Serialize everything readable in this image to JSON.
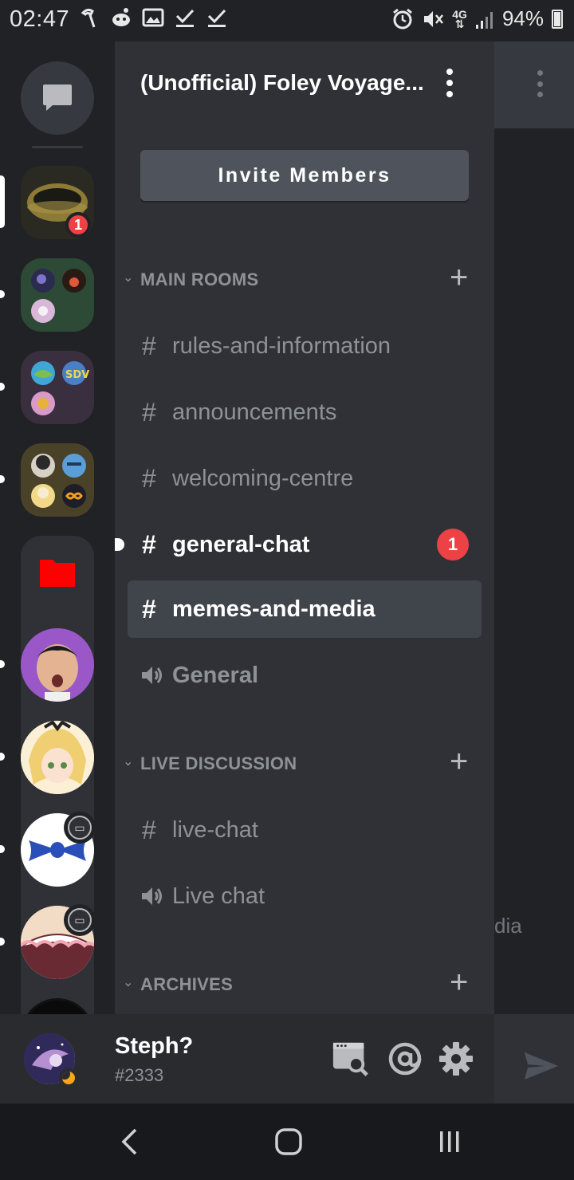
{
  "status_bar": {
    "time": "02:47",
    "left_icons": [
      "tiktok-icon",
      "reddit-icon",
      "image-icon",
      "check-icon",
      "check-icon"
    ],
    "right_icons": [
      "alarm-icon",
      "mute-icon",
      "network-4g-icon",
      "signal-icon"
    ],
    "network": "4G",
    "battery": "94%"
  },
  "rail": {
    "servers": [
      {
        "name": "ring-server",
        "badge": "1",
        "colors": [
          "#3b3b2a",
          "#a28b3c"
        ]
      },
      {
        "name": "folder-server-1",
        "colors": [
          "#2e4a37"
        ]
      },
      {
        "name": "folder-server-2",
        "colors": [
          "#3d3040"
        ]
      },
      {
        "name": "folder-server-3",
        "colors": [
          "#4a4228"
        ]
      }
    ],
    "folder_color": "#ff0000"
  },
  "panel": {
    "server_name": "(Unofficial) Foley Voyage...",
    "invite_label": "Invite Members",
    "categories": [
      {
        "label": "MAIN ROOMS"
      },
      {
        "label": "LIVE DISCUSSION"
      },
      {
        "label": "ARCHIVES"
      }
    ],
    "channels": {
      "rules": "rules-and-information",
      "announcements": "announcements",
      "welcoming": "welcoming-centre",
      "general_chat": "general-chat",
      "general_chat_badge": "1",
      "memes": "memes-and-media",
      "general_voice": "General",
      "live_chat": "live-chat",
      "live_chat_voice": "Live chat"
    },
    "hash_symbol": "#"
  },
  "peek": {
    "text": "dia"
  },
  "user": {
    "name": "Steph?",
    "discriminator": "#2333",
    "status": "idle"
  },
  "colors": {
    "accent_red": "#ed4245",
    "panel_bg": "#2f3136",
    "rail_bg": "#202225",
    "idle": "#faa61a"
  }
}
